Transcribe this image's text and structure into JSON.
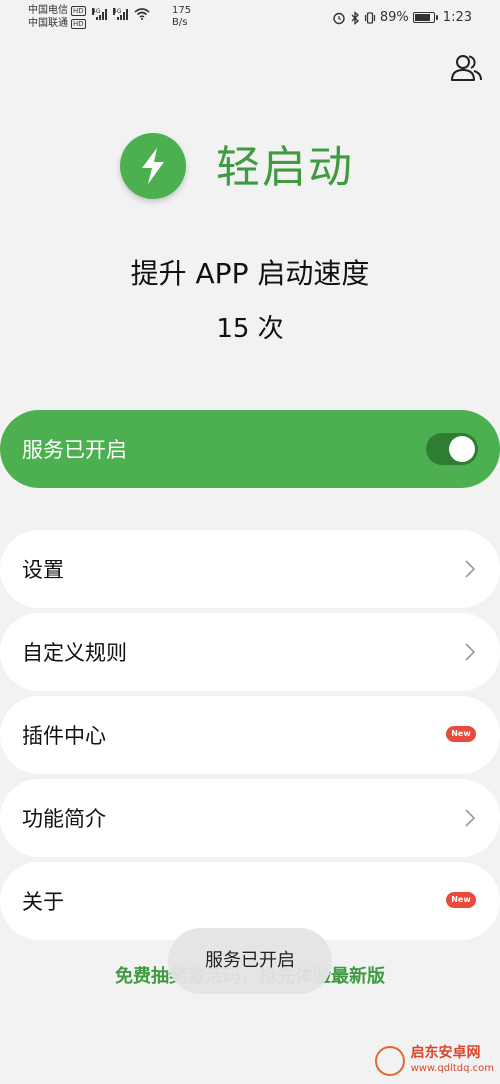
{
  "status_bar": {
    "carrier1": "中国电信",
    "carrier2": "中国联通",
    "hd": "HD",
    "net_type": "4G",
    "speed_value": "175",
    "speed_unit": "B/s",
    "battery_percent": "89%",
    "battery_level": 0.89,
    "time": "1:23"
  },
  "header": {
    "app_name": "轻启动",
    "tagline": "提升 APP 启动速度",
    "count": "15 次"
  },
  "service": {
    "label": "服务已开启",
    "enabled": true
  },
  "menu": {
    "items": [
      {
        "label": "设置",
        "trailing": "chevron"
      },
      {
        "label": "自定义规则",
        "trailing": "chevron"
      },
      {
        "label": "插件中心",
        "trailing": "badge",
        "badge": "New"
      },
      {
        "label": "功能简介",
        "trailing": "chevron"
      },
      {
        "label": "关于",
        "trailing": "badge",
        "badge": "New"
      }
    ]
  },
  "footer": {
    "promo": "免费抽奖激活码，抢先体验最新版",
    "toast": "服务已开启"
  },
  "watermark": {
    "title": "启东安卓网",
    "url": "www.qdltdq.com"
  },
  "colors": {
    "accent": "#4caf50",
    "accent_dark": "#3f9a42",
    "badge": "#e84a3b",
    "background": "#f2f2f2"
  }
}
